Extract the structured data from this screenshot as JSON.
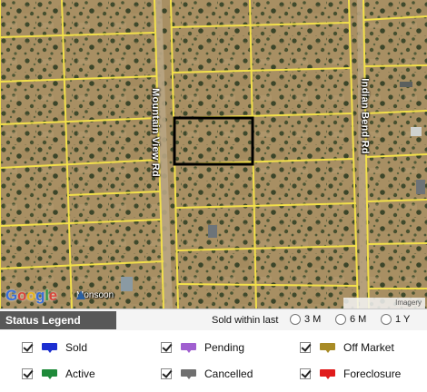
{
  "map": {
    "roads": {
      "mountain_view": "Mountain View Rd",
      "indian_bend": "Indian Bend Rd"
    },
    "attribution": {
      "google": [
        "G",
        "o",
        "o",
        "g",
        "l",
        "e"
      ],
      "provider": "Monsoon",
      "imagery_button": "Imagery"
    },
    "colors": {
      "parcel_lines": "#f2e04a",
      "selected_parcel": "#000000",
      "terrain": "#a89266"
    }
  },
  "legend": {
    "title": "Status Legend",
    "sold_within_label": "Sold within last",
    "periods": [
      {
        "label": "3 M",
        "selected": false
      },
      {
        "label": "6 M",
        "selected": false
      },
      {
        "label": "1 Y",
        "selected": false
      }
    ],
    "items": {
      "sold": {
        "label": "Sold",
        "color": "#1c2fd1",
        "checked": true
      },
      "pending": {
        "label": "Pending",
        "color": "#a05fd0",
        "checked": true
      },
      "off_market": {
        "label": "Off Market",
        "color": "#a88b26",
        "checked": true
      },
      "active": {
        "label": "Active",
        "color": "#1f8a3a",
        "checked": true
      },
      "cancelled": {
        "label": "Cancelled",
        "color": "#6f6f6f",
        "checked": true
      },
      "foreclosure": {
        "label": "Foreclosure",
        "color": "#e01b1b",
        "checked": true
      }
    }
  }
}
